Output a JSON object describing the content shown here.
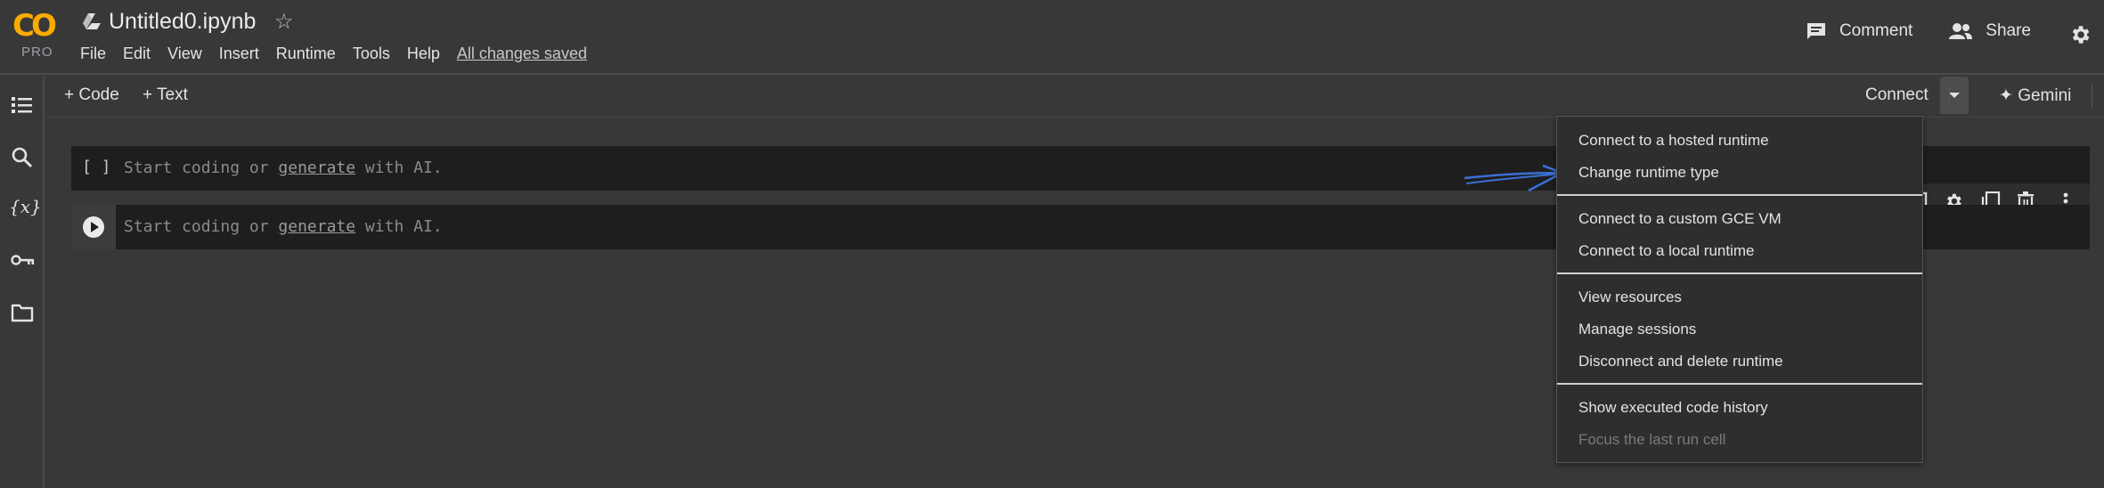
{
  "app": {
    "logo_text": "CO",
    "logo_badge": "PRO",
    "notebook_title": "Untitled0.ipynb"
  },
  "menubar": {
    "items": [
      "File",
      "Edit",
      "View",
      "Insert",
      "Runtime",
      "Tools",
      "Help"
    ],
    "save_status": "All changes saved"
  },
  "header_actions": {
    "comment_label": "Comment",
    "share_label": "Share"
  },
  "toolbar": {
    "add_code_label": "+ Code",
    "add_text_label": "+ Text",
    "connect_label": "Connect",
    "gemini_label": "✦ Gemini"
  },
  "cells": [
    {
      "prompt": "[ ]",
      "placeholder_prefix": "Start coding or ",
      "placeholder_link": "generate",
      "placeholder_suffix": " with AI."
    },
    {
      "prompt": "",
      "placeholder_prefix": "Start coding or ",
      "placeholder_link": "generate",
      "placeholder_suffix": " with AI."
    }
  ],
  "connect_menu": {
    "groups": [
      [
        "Connect to a hosted runtime",
        "Change runtime type"
      ],
      [
        "Connect to a custom GCE VM",
        "Connect to a local runtime"
      ],
      [
        "View resources",
        "Manage sessions",
        "Disconnect and delete runtime"
      ],
      [
        "Show executed code history",
        "Focus the last run cell"
      ]
    ],
    "disabled_items": [
      "Focus the last run cell"
    ]
  },
  "colors": {
    "background": "#383838",
    "cell_background": "#1e1e1e",
    "menu_background": "#2e2e2e",
    "logo_orange": "#f9ab00",
    "annotation_arrow": "#3b6fd4"
  }
}
